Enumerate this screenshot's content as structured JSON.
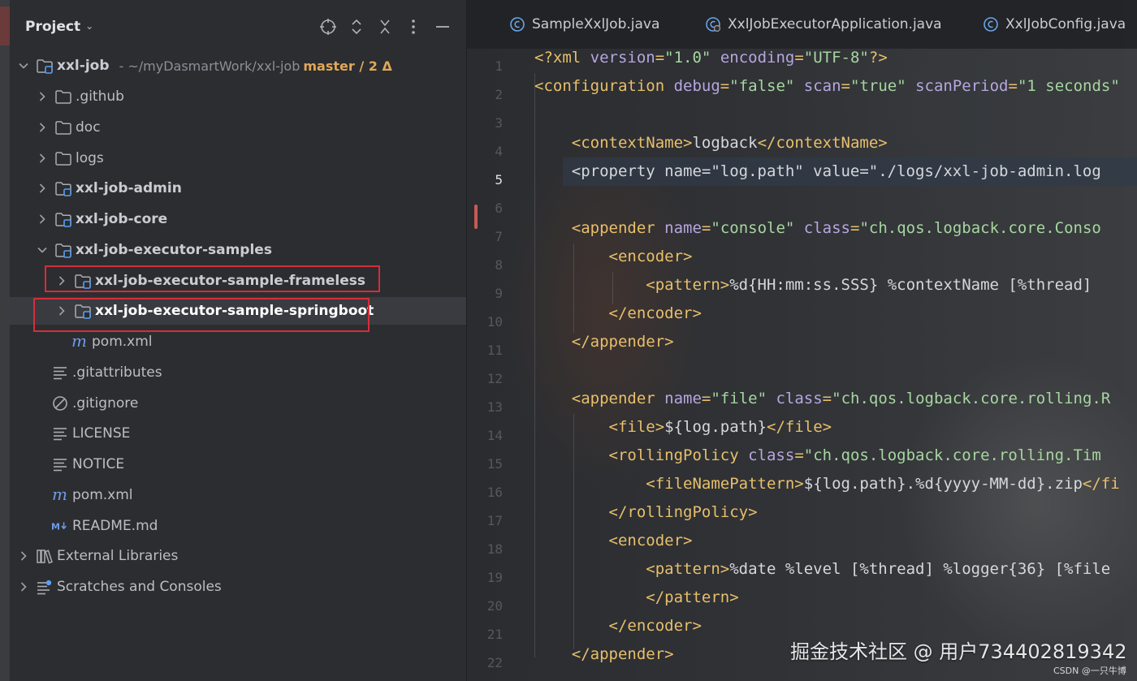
{
  "panel": {
    "title": "Project",
    "toolbar_icons": [
      "target-icon",
      "expand-collapse-icon",
      "close-icon",
      "more-icon",
      "minimize-icon"
    ]
  },
  "tree": [
    {
      "name": "xxl-job",
      "path": "- ~/myDasmartWork/xxl-job",
      "vcs": "master / 2 Δ",
      "icon": "module-folder-icon",
      "expanded": true,
      "bold": true
    },
    {
      "name": ".github",
      "icon": "folder-icon"
    },
    {
      "name": "doc",
      "icon": "folder-icon"
    },
    {
      "name": "logs",
      "icon": "folder-icon"
    },
    {
      "name": "xxl-job-admin",
      "icon": "module-folder-icon",
      "bold": true
    },
    {
      "name": "xxl-job-core",
      "icon": "module-folder-icon",
      "bold": true
    },
    {
      "name": "xxl-job-executor-samples",
      "icon": "module-folder-icon",
      "expanded": true,
      "bold": true
    },
    {
      "name": "xxl-job-executor-sample-frameless",
      "icon": "module-folder-icon",
      "bold": true,
      "highlighted": true
    },
    {
      "name": "xxl-job-executor-sample-springboot",
      "icon": "module-folder-icon",
      "bold": true,
      "highlighted": true,
      "selected": true
    },
    {
      "name": "pom.xml",
      "icon": "maven-icon"
    },
    {
      "name": ".gitattributes",
      "icon": "text-file-icon"
    },
    {
      "name": ".gitignore",
      "icon": "ignore-file-icon"
    },
    {
      "name": "LICENSE",
      "icon": "text-file-icon"
    },
    {
      "name": "NOTICE",
      "icon": "text-file-icon"
    },
    {
      "name": "pom.xml",
      "icon": "maven-icon"
    },
    {
      "name": "README.md",
      "icon": "markdown-icon"
    },
    {
      "name": "External Libraries",
      "icon": "library-icon"
    },
    {
      "name": "Scratches and Consoles",
      "icon": "scratches-icon"
    }
  ],
  "tabs": [
    {
      "label": "SampleXxlJob.java",
      "icon": "java-class-icon"
    },
    {
      "label": "XxlJobExecutorApplication.java",
      "icon": "spring-boot-class-icon"
    },
    {
      "label": "XxlJobConfig.java",
      "icon": "java-class-icon"
    }
  ],
  "editor": {
    "active_line": 5,
    "lines": [
      [
        [
          "tag",
          "<?xml "
        ],
        [
          "attr",
          "version"
        ],
        [
          "tag",
          "="
        ],
        [
          "val",
          "\"1.0\""
        ],
        [
          "tag",
          " "
        ],
        [
          "attr",
          "encoding"
        ],
        [
          "tag",
          "="
        ],
        [
          "val",
          "\"UTF-8\""
        ],
        [
          "tag",
          "?>"
        ]
      ],
      [
        [
          "tag",
          "<configuration "
        ],
        [
          "attr",
          "debug"
        ],
        [
          "tag",
          "="
        ],
        [
          "val",
          "\"false\""
        ],
        [
          "tag",
          " "
        ],
        [
          "attr",
          "scan"
        ],
        [
          "tag",
          "="
        ],
        [
          "val",
          "\"true\""
        ],
        [
          "tag",
          " "
        ],
        [
          "attr",
          "scanPeriod"
        ],
        [
          "tag",
          "="
        ],
        [
          "val",
          "\"1 seconds\""
        ]
      ],
      [],
      [
        [
          "text",
          "    "
        ],
        [
          "tag",
          "<contextName>"
        ],
        [
          "text",
          "logback"
        ],
        [
          "tag",
          "</contextName>"
        ]
      ],
      [
        [
          "text",
          "    <property name=\"log.path\" value=\"./logs/xxl-job-admin.log"
        ]
      ],
      [],
      [
        [
          "text",
          "    "
        ],
        [
          "tag",
          "<appender "
        ],
        [
          "attr",
          "name"
        ],
        [
          "tag",
          "="
        ],
        [
          "val",
          "\"console\""
        ],
        [
          "tag",
          " "
        ],
        [
          "attr",
          "class"
        ],
        [
          "tag",
          "="
        ],
        [
          "val",
          "\"ch.qos.logback.core.Conso"
        ]
      ],
      [
        [
          "text",
          "        "
        ],
        [
          "tag",
          "<encoder>"
        ]
      ],
      [
        [
          "text",
          "            "
        ],
        [
          "tag",
          "<pattern>"
        ],
        [
          "text",
          "%d{HH:mm:ss.SSS} %contextName [%thread]"
        ]
      ],
      [
        [
          "text",
          "        "
        ],
        [
          "tag",
          "</encoder>"
        ]
      ],
      [
        [
          "text",
          "    "
        ],
        [
          "tag",
          "</appender>"
        ]
      ],
      [],
      [
        [
          "text",
          "    "
        ],
        [
          "tag",
          "<appender "
        ],
        [
          "attr",
          "name"
        ],
        [
          "tag",
          "="
        ],
        [
          "val",
          "\"file\""
        ],
        [
          "tag",
          " "
        ],
        [
          "attr",
          "class"
        ],
        [
          "tag",
          "="
        ],
        [
          "val",
          "\"ch.qos.logback.core.rolling.R"
        ]
      ],
      [
        [
          "text",
          "        "
        ],
        [
          "tag",
          "<file>"
        ],
        [
          "text",
          "${log.path}"
        ],
        [
          "tag",
          "</file>"
        ]
      ],
      [
        [
          "text",
          "        "
        ],
        [
          "tag",
          "<rollingPolicy "
        ],
        [
          "attr",
          "class"
        ],
        [
          "tag",
          "="
        ],
        [
          "val",
          "\"ch.qos.logback.core.rolling.Tim"
        ]
      ],
      [
        [
          "text",
          "            "
        ],
        [
          "tag",
          "<fileNamePattern>"
        ],
        [
          "text",
          "${log.path}.%d{yyyy-MM-dd}.zip"
        ],
        [
          "tag",
          "</fi"
        ]
      ],
      [
        [
          "text",
          "        "
        ],
        [
          "tag",
          "</rollingPolicy>"
        ]
      ],
      [
        [
          "text",
          "        "
        ],
        [
          "tag",
          "<encoder>"
        ]
      ],
      [
        [
          "text",
          "            "
        ],
        [
          "tag",
          "<pattern>"
        ],
        [
          "text",
          "%date %level [%thread] %logger{36} [%file"
        ]
      ],
      [
        [
          "text",
          "            "
        ],
        [
          "tag",
          "</pattern>"
        ]
      ],
      [
        [
          "text",
          "        "
        ],
        [
          "tag",
          "</encoder>"
        ]
      ],
      [
        [
          "text",
          "    "
        ],
        [
          "tag",
          "</appender>"
        ]
      ]
    ]
  },
  "watermark": {
    "main": "掘金技术社区 @ 用户734402819342",
    "small": "CSDN @一只牛博"
  }
}
